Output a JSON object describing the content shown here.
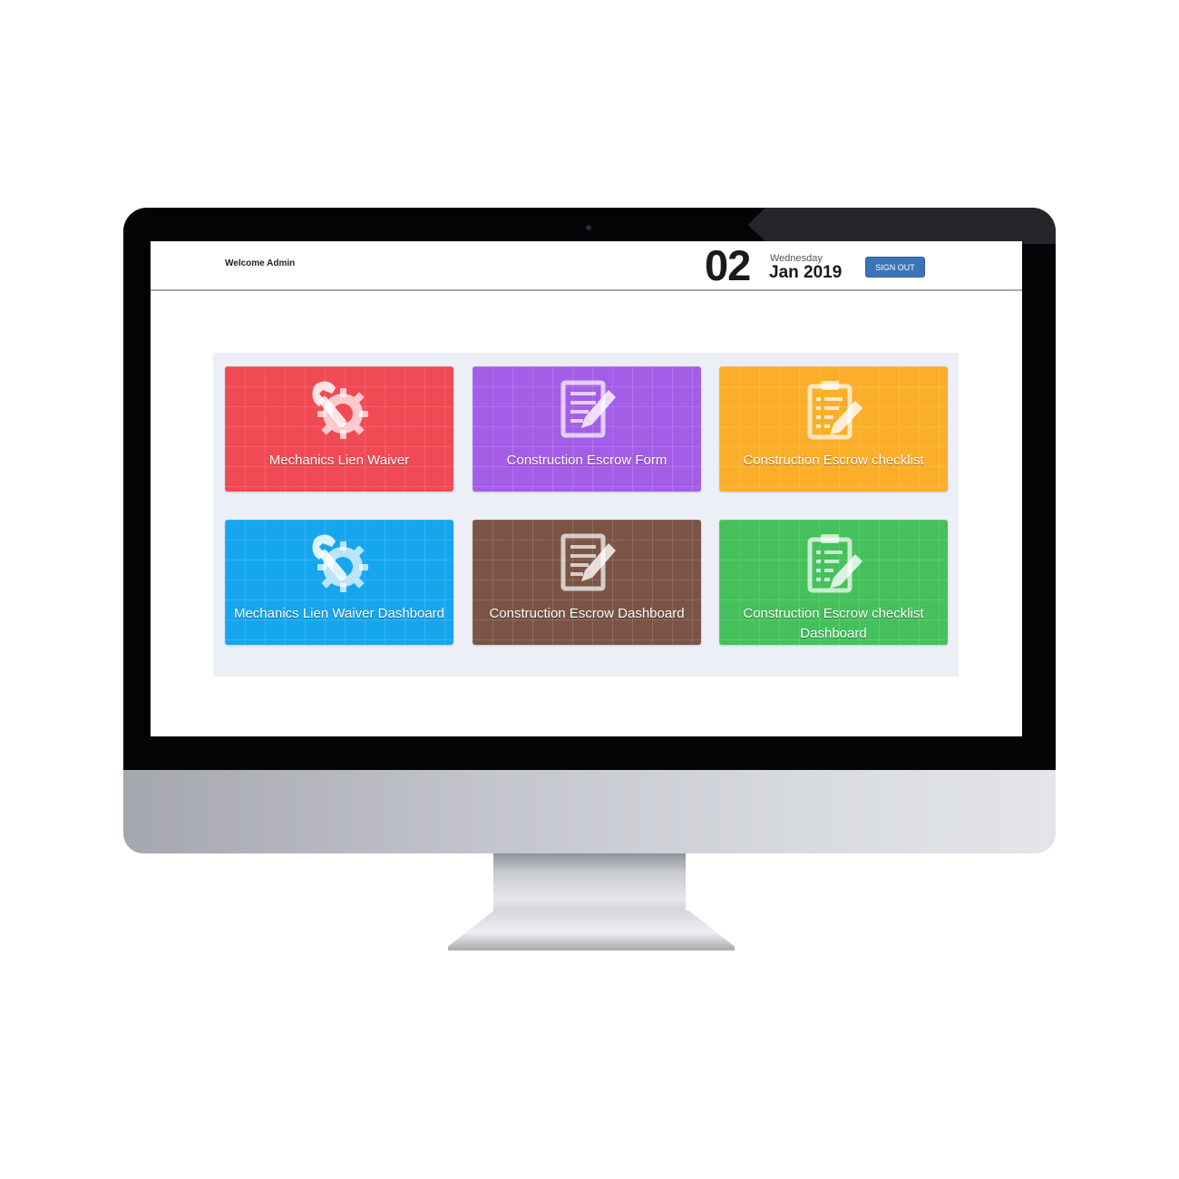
{
  "header": {
    "welcome": "Welcome Admin",
    "date_day": "02",
    "date_weekday": "Wednesday",
    "date_month_year": "Jan 2019",
    "signout_label": "SIGN OUT"
  },
  "tiles": [
    {
      "label": "Mechanics Lien Waiver",
      "color": "#f04a54",
      "icon": "wrench-gear-icon"
    },
    {
      "label": "Construction Escrow Form",
      "color": "#a45de6",
      "icon": "document-pencil-icon"
    },
    {
      "label": "Construction Escrow checklist",
      "color": "#fbae2a",
      "icon": "clipboard-pencil-icon"
    },
    {
      "label": "Mechanics Lien Waiver Dashboard",
      "color": "#16a6ee",
      "icon": "wrench-gear-icon"
    },
    {
      "label": "Construction Escrow Dashboard",
      "color": "#7a5445",
      "icon": "document-pencil-icon"
    },
    {
      "label": "Construction Escrow checklist Dashboard",
      "color": "#45c05c",
      "icon": "clipboard-pencil-icon"
    }
  ]
}
